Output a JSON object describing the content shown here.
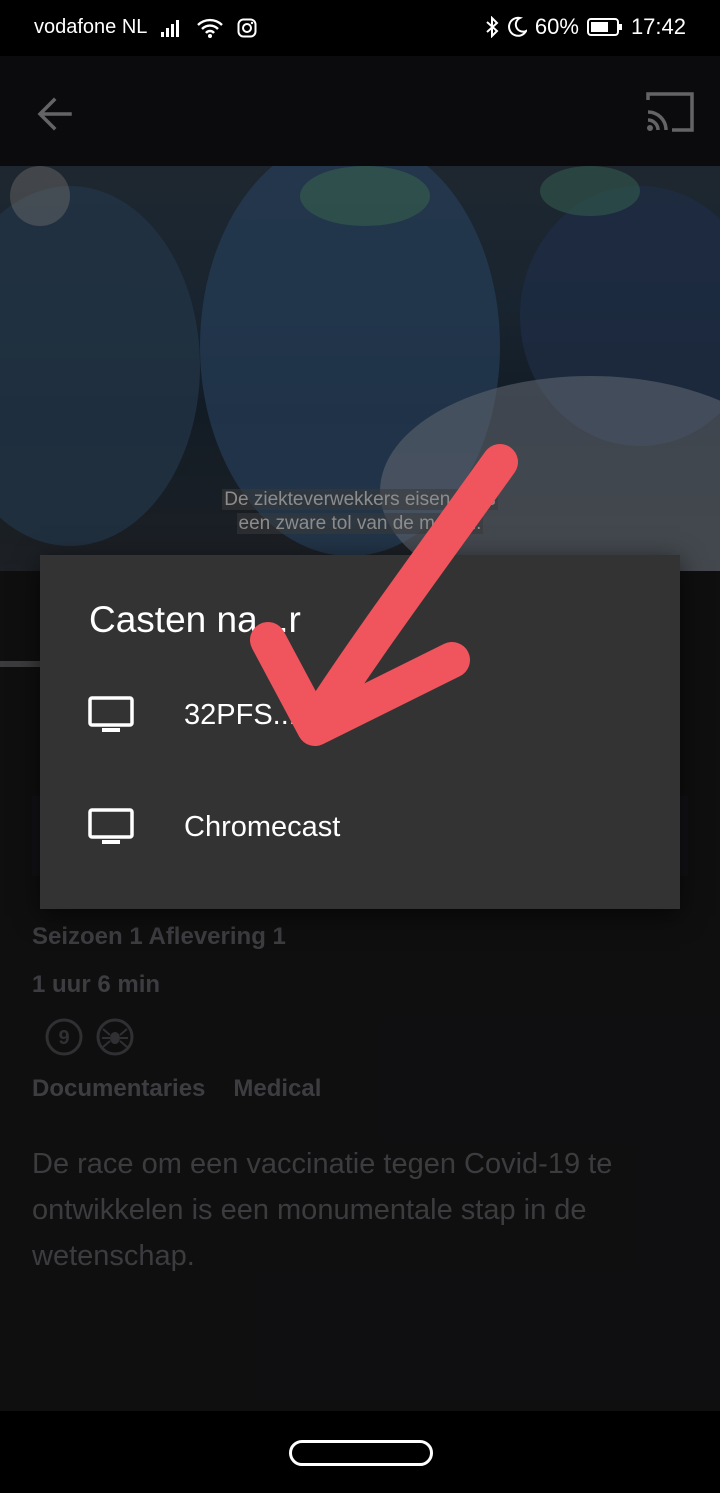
{
  "status_bar": {
    "carrier": "vodafone NL",
    "battery": "60%",
    "time": "17:42",
    "icons": [
      "signal-icon",
      "wifi-icon",
      "instagram-icon",
      "bluetooth-icon",
      "moon-icon",
      "battery-icon"
    ]
  },
  "app_bar": {
    "back_icon": "back-arrow-icon",
    "cast_icon": "cast-icon"
  },
  "video": {
    "subtitle_line1": "De ziekteverwekkers eisen ...jes",
    "subtitle_line2": "een zware tol van de m...eid."
  },
  "dialog": {
    "title": "Casten na...r",
    "devices": [
      {
        "name": "32PFS...2",
        "icon": "tv-icon"
      },
      {
        "name": "Chromecast",
        "icon": "tv-icon"
      }
    ]
  },
  "episode": {
    "season_episode": "Seizoen 1 Aflevering 1",
    "duration": "1 uur 6 min",
    "age_rating": "9",
    "rating_icons": [
      "age-9-icon",
      "spider-icon"
    ],
    "genres": [
      "Documentaries",
      "Medical"
    ],
    "description": "De race om een vaccinatie tegen Covid-19 te ontwikkelen is een monumentale stap in de wetenschap."
  },
  "colors": {
    "annotation_arrow": "#f0545c",
    "dialog_bg": "#333334",
    "page_bg": "#17171a"
  }
}
